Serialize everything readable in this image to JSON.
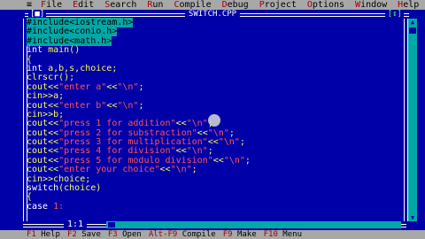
{
  "menu": {
    "system": "≡",
    "items": [
      "File",
      "Edit",
      "Search",
      "Run",
      "Compile",
      "Debug",
      "Project",
      "Options"
    ],
    "right_items": [
      "Window",
      "Help"
    ]
  },
  "window": {
    "close_box": "[■]",
    "title": "SWITCH.CPP",
    "number": "1",
    "zoom_box": "[↕]"
  },
  "code_lines": [
    {
      "parts": [
        {
          "t": "#include<iostream.h>",
          "c": "sel"
        }
      ]
    },
    {
      "parts": [
        {
          "t": "#include<conio.h>",
          "c": "sel"
        }
      ]
    },
    {
      "parts": [
        {
          "t": "#include<math.h>",
          "c": "sel"
        }
      ]
    },
    {
      "parts": [
        {
          "t": "int",
          "c": "kw"
        },
        {
          "t": " main",
          "c": "id"
        },
        {
          "t": "()",
          "c": "sym"
        }
      ]
    },
    {
      "parts": [
        {
          "t": "{",
          "c": "sym"
        }
      ]
    },
    {
      "parts": [
        {
          "t": "int",
          "c": "kw"
        },
        {
          "t": " a,b,s,choice;",
          "c": "id"
        }
      ]
    },
    {
      "parts": [
        {
          "t": "clrscr();",
          "c": "id"
        }
      ]
    },
    {
      "parts": [
        {
          "t": "cout<<",
          "c": "id"
        },
        {
          "t": "\"enter a\"",
          "c": "str"
        },
        {
          "t": "<<",
          "c": "id"
        },
        {
          "t": "\"\\n\"",
          "c": "str"
        },
        {
          "t": ";",
          "c": "id"
        }
      ]
    },
    {
      "parts": [
        {
          "t": "cin>>a;",
          "c": "id"
        }
      ]
    },
    {
      "parts": [
        {
          "t": "cout<<",
          "c": "id"
        },
        {
          "t": "\"enter b\"",
          "c": "str"
        },
        {
          "t": "<<",
          "c": "id"
        },
        {
          "t": "\"\\n\"",
          "c": "str"
        },
        {
          "t": ";",
          "c": "id"
        }
      ]
    },
    {
      "parts": [
        {
          "t": "cin>>b;",
          "c": "id"
        }
      ]
    },
    {
      "parts": [
        {
          "t": "cout<<",
          "c": "id"
        },
        {
          "t": "\"press 1 for addition\"",
          "c": "str"
        },
        {
          "t": "<<",
          "c": "id"
        },
        {
          "t": "\"\\n\"",
          "c": "str"
        },
        {
          "t": ";",
          "c": "id"
        }
      ]
    },
    {
      "parts": [
        {
          "t": "cout<<",
          "c": "id"
        },
        {
          "t": "\"press 2 for substraction\"",
          "c": "str"
        },
        {
          "t": "<<",
          "c": "id"
        },
        {
          "t": "\"\\n\"",
          "c": "str"
        },
        {
          "t": ";",
          "c": "id"
        }
      ]
    },
    {
      "parts": [
        {
          "t": "cout<<",
          "c": "id"
        },
        {
          "t": "\"press 3 for multiplication\"",
          "c": "str"
        },
        {
          "t": "<<",
          "c": "id"
        },
        {
          "t": "\"\\n\"",
          "c": "str"
        },
        {
          "t": ";",
          "c": "id"
        }
      ]
    },
    {
      "parts": [
        {
          "t": "cout<<",
          "c": "id"
        },
        {
          "t": "\"press 4 for division\"",
          "c": "str"
        },
        {
          "t": "<<",
          "c": "id"
        },
        {
          "t": "\"\\n\"",
          "c": "str"
        },
        {
          "t": ";",
          "c": "id"
        }
      ]
    },
    {
      "parts": [
        {
          "t": "cout<<",
          "c": "id"
        },
        {
          "t": "\"press 5 for modulo division\"",
          "c": "str"
        },
        {
          "t": "<<",
          "c": "id"
        },
        {
          "t": "\"\\n\"",
          "c": "str"
        },
        {
          "t": ";",
          "c": "id"
        }
      ]
    },
    {
      "parts": [
        {
          "t": "cout<<",
          "c": "id"
        },
        {
          "t": "\"enter your choice\"",
          "c": "str"
        },
        {
          "t": "<<",
          "c": "id"
        },
        {
          "t": "\"\\n\"",
          "c": "str"
        },
        {
          "t": ";",
          "c": "id"
        }
      ]
    },
    {
      "parts": [
        {
          "t": "cin>>choice;",
          "c": "id"
        }
      ]
    },
    {
      "parts": [
        {
          "t": "switch",
          "c": "kw"
        },
        {
          "t": "(choice)",
          "c": "id"
        }
      ]
    },
    {
      "parts": [
        {
          "t": "{",
          "c": "sym"
        }
      ]
    },
    {
      "parts": [
        {
          "t": "case",
          "c": "kw"
        },
        {
          "t": " 1:",
          "c": "num"
        }
      ]
    }
  ],
  "status": {
    "cursor_position": "1:1"
  },
  "fkeys": [
    {
      "key": "F1",
      "label": " Help"
    },
    {
      "key": "F2",
      "label": " Save"
    },
    {
      "key": "F3",
      "label": " Open"
    },
    {
      "key": "Alt-F9",
      "label": " Compile"
    },
    {
      "key": "F9",
      "label": " Make"
    },
    {
      "key": "F10",
      "label": " Menu"
    }
  ]
}
